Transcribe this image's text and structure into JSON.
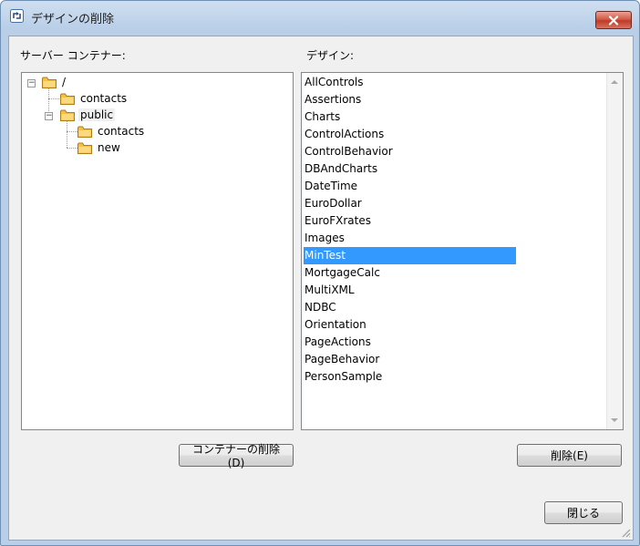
{
  "window": {
    "title": "デザインの削除",
    "close_glyph": "✕"
  },
  "labels": {
    "server_containers": "サーバー コンテナー:",
    "designs": "デザイン:"
  },
  "tree": {
    "root": "/",
    "root_child": "contacts",
    "public": "public",
    "public_children": [
      "contacts",
      "new"
    ]
  },
  "designs": {
    "items": [
      "AllControls",
      "Assertions",
      "Charts",
      "ControlActions",
      "ControlBehavior",
      "DBAndCharts",
      "DateTime",
      "EuroDollar",
      "EuroFXrates",
      "Images",
      "MinTest",
      "MortgageCalc",
      "MultiXML",
      "NDBC",
      "Orientation",
      "PageActions",
      "PageBehavior",
      "PersonSample"
    ],
    "selected": "MinTest"
  },
  "buttons": {
    "delete_container": "コンテナーの削除(D)",
    "delete": "削除(E)",
    "close": "閉じる"
  },
  "icons": {
    "folder": "folder-icon",
    "title": "design-delete-icon",
    "close": "close-icon"
  },
  "colors": {
    "selection": "#3399ff",
    "close_button": "#c13b25",
    "folder": "#f5c04a"
  }
}
